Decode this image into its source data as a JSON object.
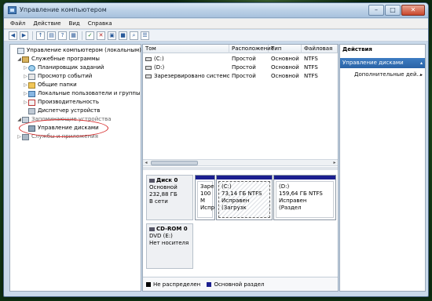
{
  "window": {
    "title": "Управление компьютером",
    "controls": {
      "minimize": "–",
      "maximize": "□",
      "close": "✕"
    }
  },
  "menu": [
    "Файл",
    "Действие",
    "Вид",
    "Справка"
  ],
  "toolbar": {
    "buttons": [
      "back-icon",
      "forward-icon",
      "up-folder-icon",
      "show-hide-tree-icon",
      "help-icon",
      "properties-icon",
      "refresh-icon",
      "delete-icon",
      "open-icon",
      "save-icon",
      "search-icon",
      "settings-icon"
    ]
  },
  "tree": {
    "items": [
      {
        "label": "Управление компьютером (локальным)",
        "icon": "computer-icon",
        "expander": "",
        "level": 0
      },
      {
        "label": "Служебные программы",
        "icon": "tools-icon",
        "expander": "◢",
        "level": 1
      },
      {
        "label": "Планировщик заданий",
        "icon": "clock-icon",
        "expander": "▷",
        "level": 2
      },
      {
        "label": "Просмотр событий",
        "icon": "event-log-icon",
        "expander": "▷",
        "level": 2
      },
      {
        "label": "Общие папки",
        "icon": "folder-icon",
        "expander": "▷",
        "level": 2
      },
      {
        "label": "Локальные пользователи и группы",
        "icon": "users-icon",
        "expander": "▷",
        "level": 2
      },
      {
        "label": "Производительность",
        "icon": "performance-icon",
        "expander": "▷",
        "level": 2
      },
      {
        "label": "Диспетчер устройств",
        "icon": "device-manager-icon",
        "expander": "",
        "level": 2
      },
      {
        "label": "Запоминающие устройства",
        "icon": "storage-icon",
        "expander": "◢",
        "level": 1
      },
      {
        "label": "Управление дисками",
        "icon": "disk-management-icon",
        "expander": "",
        "level": 2
      },
      {
        "label": "Службы и приложения",
        "icon": "services-icon",
        "expander": "▷",
        "level": 1
      }
    ]
  },
  "volumes": {
    "columns": [
      "Том",
      "Расположение",
      "Тип",
      "Файловая"
    ],
    "rows": [
      {
        "name": "(C:)",
        "layout": "Простой",
        "type": "Основной",
        "fs": "NTFS"
      },
      {
        "name": "(D:)",
        "layout": "Простой",
        "type": "Основной",
        "fs": "NTFS"
      },
      {
        "name": "Зарезервировано системой",
        "layout": "Простой",
        "type": "Основной",
        "fs": "NTFS"
      }
    ]
  },
  "disks": [
    {
      "name": "Диск 0",
      "type": "Основной",
      "size": "232,88 ГБ",
      "status": "В сети",
      "partitions": [
        {
          "label": "Зарез",
          "line2": "100 М",
          "line3": "Испра"
        },
        {
          "label": "(C:)",
          "line2": "73,14 ГБ NTFS",
          "line3": "Исправен (Загрузк"
        },
        {
          "label": "(D:)",
          "line2": "159,64 ГБ NTFS",
          "line3": "Исправен (Раздел"
        }
      ]
    },
    {
      "name": "CD-ROM 0",
      "type": "DVD (E:)",
      "size": "",
      "status": "Нет носителя",
      "partitions": []
    }
  ],
  "legend": [
    {
      "label": "Не распределен",
      "color": "#000000"
    },
    {
      "label": "Основной раздел",
      "color": "#1b1f8f"
    }
  ],
  "actions": {
    "title": "Действия",
    "section": "Управление дисками",
    "item": "Дополнительные дей..."
  }
}
